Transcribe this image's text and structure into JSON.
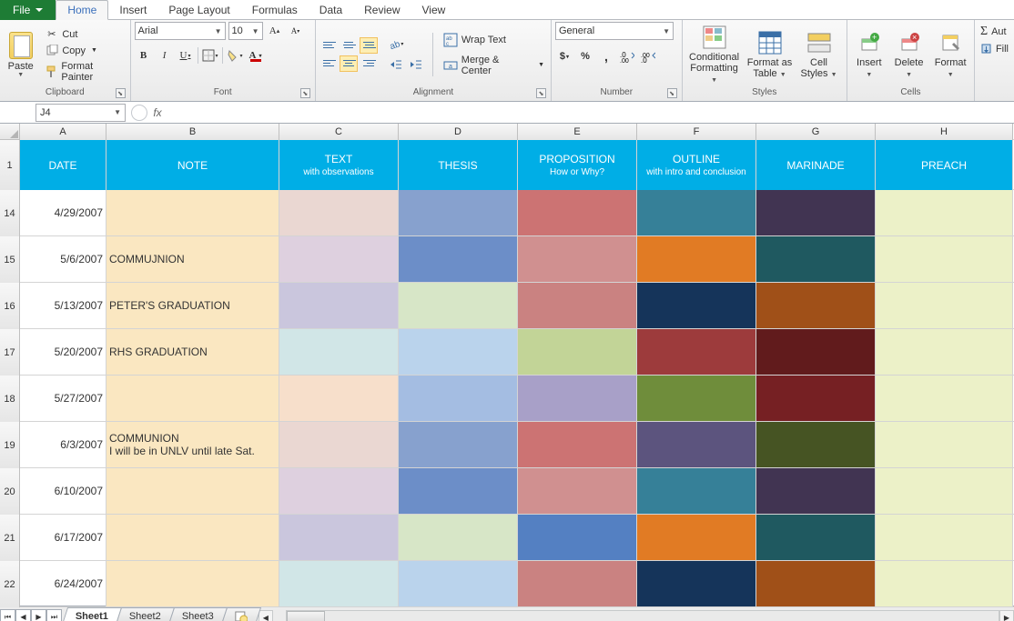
{
  "tabs": {
    "file": "File",
    "home": "Home",
    "insert": "Insert",
    "page_layout": "Page Layout",
    "formulas": "Formulas",
    "data": "Data",
    "review": "Review",
    "view": "View"
  },
  "clipboard": {
    "paste": "Paste",
    "cut": "Cut",
    "copy": "Copy",
    "format_painter": "Format Painter",
    "label": "Clipboard"
  },
  "font": {
    "name": "Arial",
    "size": "10",
    "label": "Font"
  },
  "alignment": {
    "wrap": "Wrap Text",
    "merge": "Merge & Center",
    "label": "Alignment"
  },
  "number": {
    "format": "General",
    "label": "Number"
  },
  "styles": {
    "conditional": "Conditional Formatting",
    "as_table": "Format as Table",
    "cell_styles": "Cell Styles",
    "label": "Styles"
  },
  "cells": {
    "insert": "Insert",
    "delete": "Delete",
    "format": "Format",
    "label": "Cells"
  },
  "editing": {
    "autosum": "Aut",
    "fill": "Fill"
  },
  "namebox": "J4",
  "formula": "",
  "cols": [
    "A",
    "B",
    "C",
    "D",
    "E",
    "F",
    "G",
    "H"
  ],
  "headers": [
    {
      "t": "DATE"
    },
    {
      "t": "NOTE"
    },
    {
      "t": "TEXT",
      "s": "with observations"
    },
    {
      "t": "THESIS"
    },
    {
      "t": "PROPOSITION",
      "s": "How or Why?"
    },
    {
      "t": "OUTLINE",
      "s": "with intro and conclusion"
    },
    {
      "t": "MARINADE"
    },
    {
      "t": "PREACH"
    }
  ],
  "rows": [
    {
      "n": 14,
      "date": "4/29/2007",
      "note": "",
      "bg": [
        "#fae7c1",
        "#ead7d2",
        "#87a1ce",
        "#cc7373",
        "#368098",
        "#413452",
        "#ecf1c8"
      ]
    },
    {
      "n": 15,
      "date": "5/6/2007",
      "note": "COMMUJNION",
      "bg": [
        "#fae7c1",
        "#ded0df",
        "#6c8ec8",
        "#d09090",
        "#e17b24",
        "#1f5960",
        "#ecf1c8"
      ]
    },
    {
      "n": 16,
      "date": "5/13/2007",
      "note": "PETER'S GRADUATION",
      "bg": [
        "#fae7c1",
        "#cac6dd",
        "#d7e6c7",
        "#ca8281",
        "#15345a",
        "#a05018",
        "#ecf1c8"
      ]
    },
    {
      "n": 17,
      "date": "5/20/2007",
      "note": "RHS GRADUATION",
      "bg": [
        "#fae7c1",
        "#d1e6e7",
        "#bad3ec",
        "#c2d497",
        "#9d3b3c",
        "#611b1c",
        "#ecf1c8"
      ]
    },
    {
      "n": 18,
      "date": "5/27/2007",
      "note": "",
      "bg": [
        "#fae7c1",
        "#f7dfcb",
        "#a4bde2",
        "#a8a0c8",
        "#6f8d3b",
        "#762023",
        "#ecf1c8"
      ]
    },
    {
      "n": 19,
      "date": "6/3/2007",
      "note": "COMMUNION\nI will be in UNLV until late Sat.",
      "bg": [
        "#fae7c1",
        "#ead7d2",
        "#87a1ce",
        "#cc7373",
        "#5c547e",
        "#465423",
        "#ecf1c8"
      ]
    },
    {
      "n": 20,
      "date": "6/10/2007",
      "note": "",
      "bg": [
        "#fae7c1",
        "#ded0df",
        "#6c8ec8",
        "#d09090",
        "#368098",
        "#413452",
        "#ecf1c8"
      ]
    },
    {
      "n": 21,
      "date": "6/17/2007",
      "note": "",
      "bg": [
        "#fae7c1",
        "#cac6dd",
        "#d7e6c7",
        "#5480c2",
        "#e17b24",
        "#1f5960",
        "#ecf1c8"
      ]
    },
    {
      "n": 22,
      "date": "6/24/2007",
      "note": "",
      "bg": [
        "#fae7c1",
        "#d1e6e7",
        "#bad3ec",
        "#ca8281",
        "#15345a",
        "#a05018",
        "#ecf1c8"
      ]
    }
  ],
  "sheets": [
    "Sheet1",
    "Sheet2",
    "Sheet3"
  ]
}
